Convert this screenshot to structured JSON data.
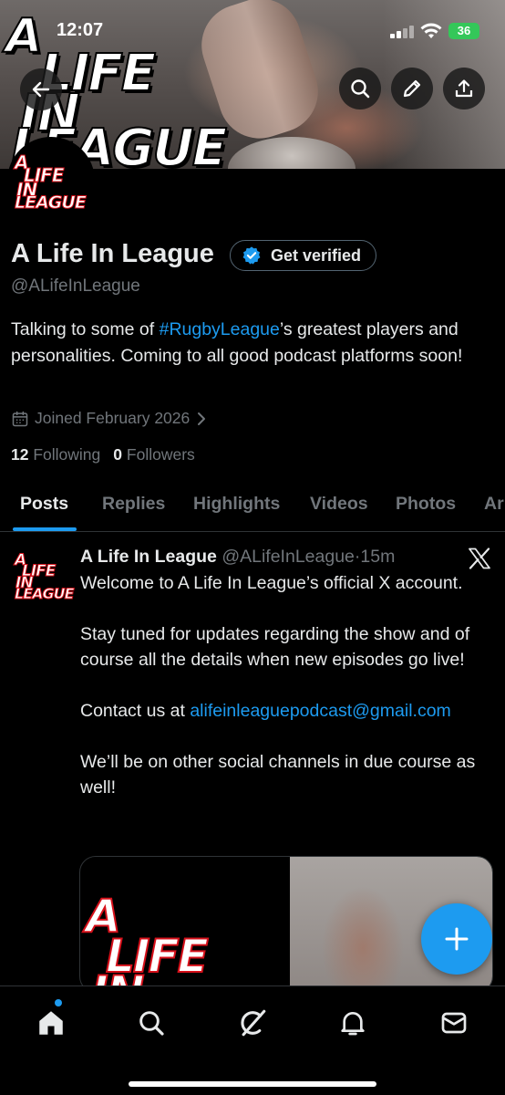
{
  "status_bar": {
    "time": "12:07",
    "battery": "36"
  },
  "banner": {
    "logo_lines": [
      "A",
      "LIFE",
      "IN",
      "LEAGUE"
    ]
  },
  "avatar_logo": [
    "A",
    "LIFE",
    "IN",
    "LEAGUE"
  ],
  "profile": {
    "name": "A Life In League",
    "verified_button": "Get verified",
    "handle": "@ALifeInLeague",
    "bio_before": "Talking to some of ",
    "bio_hashtag": "#RugbyLeague",
    "bio_after": "’s greatest players and personalities. Coming to all good podcast platforms soon!",
    "joined": "Joined February 2026",
    "following_count": "12",
    "following_label": "Following",
    "followers_count": "0",
    "followers_label": "Followers"
  },
  "tabs": [
    "Posts",
    "Replies",
    "Highlights",
    "Videos",
    "Photos",
    "Ar"
  ],
  "post": {
    "name": "A Life In League",
    "handle": "@ALifeInLeague",
    "separator": "·",
    "time": "15m",
    "line1": "Welcome to A Life In League’s official X account.",
    "line2": "Stay tuned for updates regarding the show and of course all the details when new episodes go live!",
    "line3_prefix": "Contact us at ",
    "line3_email": "alifeinleaguepodcast@gmail.com",
    "line4": "We’ll be on other social channels in due course as well!",
    "media_logo": [
      "A",
      "LIFE",
      "IN"
    ]
  },
  "icons": {
    "back": "arrow-left-icon",
    "search": "search-icon",
    "edit": "pencil-icon",
    "share": "share-icon",
    "calendar": "calendar-icon",
    "x": "x-logo-icon",
    "compose": "plus-icon",
    "nav": [
      "home-icon",
      "search-icon",
      "grok-icon",
      "bell-icon",
      "mail-icon"
    ]
  },
  "colors": {
    "accent": "#1d9bf0",
    "muted": "#71767b",
    "text": "#e7e9ea",
    "brand_red": "#d6101a"
  }
}
